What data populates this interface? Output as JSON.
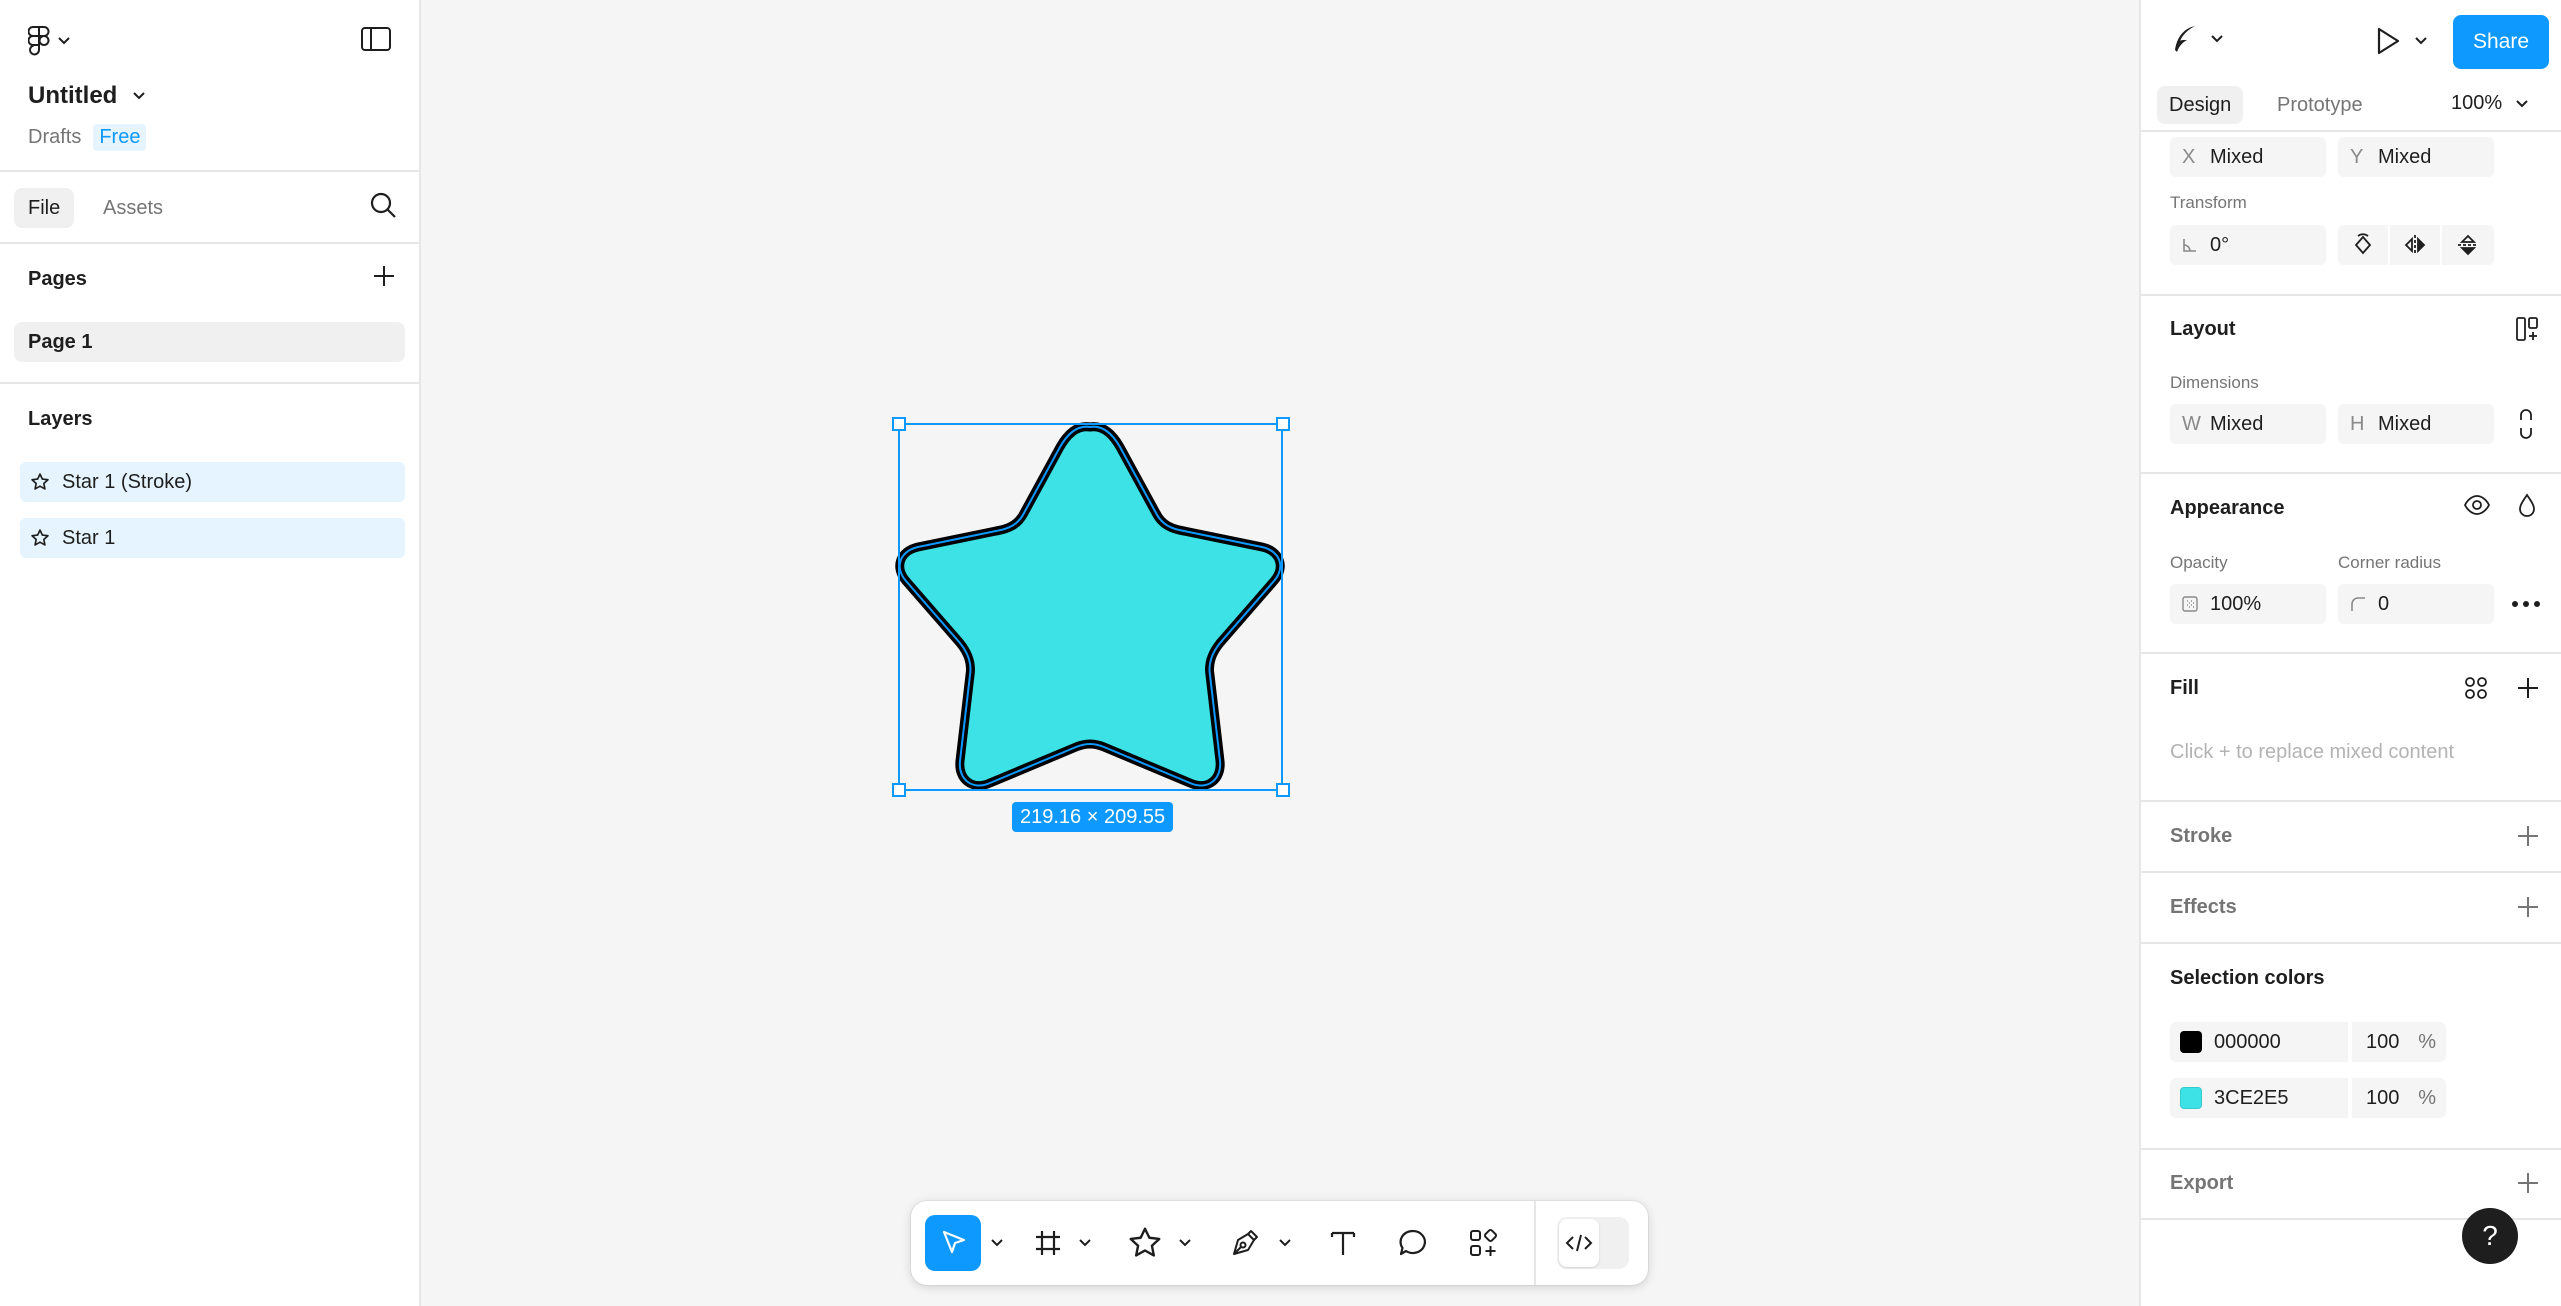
{
  "file": {
    "title": "Untitled",
    "location": "Drafts",
    "plan_badge": "Free"
  },
  "left_tabs": {
    "file": "File",
    "assets": "Assets"
  },
  "pages": {
    "title": "Pages",
    "items": [
      {
        "label": "Page 1"
      }
    ]
  },
  "layers": {
    "title": "Layers",
    "items": [
      {
        "label": "Star 1 (Stroke)"
      },
      {
        "label": "Star 1"
      }
    ]
  },
  "canvas": {
    "selection_size": "219.16 × 209.55",
    "star_fill": "#3CE2E5",
    "star_stroke": "#000000",
    "selection_color": "#0D99FF"
  },
  "toolbar": {
    "tools": [
      "move-tool",
      "frame-tool",
      "star-tool",
      "pen-tool",
      "text-tool",
      "comment-tool",
      "actions-tool",
      "dev-mode-toggle"
    ]
  },
  "header": {
    "share_label": "Share",
    "tabs": {
      "design": "Design",
      "prototype": "Prototype"
    },
    "zoom": "100%"
  },
  "position": {
    "x_prefix": "X",
    "x_value": "Mixed",
    "y_prefix": "Y",
    "y_value": "Mixed"
  },
  "transform": {
    "label": "Transform",
    "rotation": "0°"
  },
  "layout": {
    "title": "Layout",
    "dimensions_label": "Dimensions",
    "w_prefix": "W",
    "w_value": "Mixed",
    "h_prefix": "H",
    "h_value": "Mixed"
  },
  "appearance": {
    "title": "Appearance",
    "opacity_label": "Opacity",
    "opacity_value": "100%",
    "radius_label": "Corner radius",
    "radius_value": "0"
  },
  "fill": {
    "title": "Fill",
    "hint": "Click + to replace mixed content"
  },
  "stroke": {
    "title": "Stroke"
  },
  "effects": {
    "title": "Effects"
  },
  "selection_colors": {
    "title": "Selection colors",
    "items": [
      {
        "hex": "000000",
        "opacity": "100",
        "unit": "%",
        "color": "#000000"
      },
      {
        "hex": "3CE2E5",
        "opacity": "100",
        "unit": "%",
        "color": "#3CE2E5"
      }
    ]
  },
  "export": {
    "title": "Export"
  },
  "help": {
    "label": "?"
  }
}
